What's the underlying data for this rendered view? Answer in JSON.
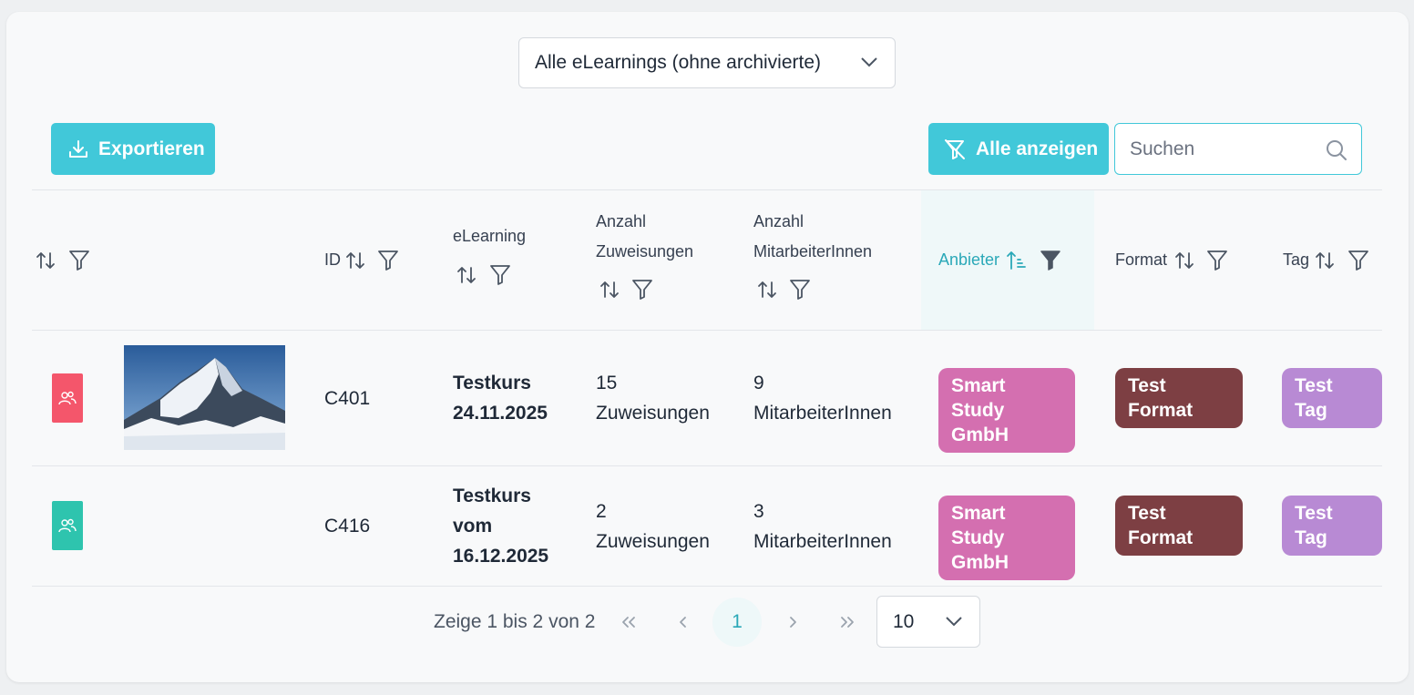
{
  "filter_dropdown": {
    "selected": "Alle eLearnings (ohne archivierte)"
  },
  "toolbar": {
    "export_label": "Exportieren",
    "show_all_label": "Alle anzeigen",
    "search_placeholder": "Suchen"
  },
  "columns": {
    "id": "ID",
    "elearning": "eLearning",
    "assignments_line1": "Anzahl",
    "assignments_line2": "Zuweisungen",
    "employees_line1": "Anzahl",
    "employees_line2": "MitarbeiterInnen",
    "provider": "Anbieter",
    "format": "Format",
    "tag": "Tag"
  },
  "rows": [
    {
      "status_color": "#f4566b",
      "has_image": true,
      "id": "C401",
      "title_lines": [
        "Testkurs",
        "24.11.2025"
      ],
      "assignments_count": "15",
      "assignments_unit": "Zuweisungen",
      "employees_count": "9",
      "employees_unit": "MitarbeiterInnen",
      "provider_lines": [
        "Smart Study",
        "GmbH"
      ],
      "format_lines": [
        "Test",
        "Format"
      ],
      "tag_lines": [
        "Test",
        "Tag"
      ]
    },
    {
      "status_color": "#2ec4ae",
      "has_image": false,
      "id": "C416",
      "title_lines": [
        "Testkurs",
        "vom",
        "16.12.2025"
      ],
      "assignments_count": "2",
      "assignments_unit": "Zuweisungen",
      "employees_count": "3",
      "employees_unit": "MitarbeiterInnen",
      "provider_lines": [
        "Smart Study",
        "GmbH"
      ],
      "format_lines": [
        "Test",
        "Format"
      ],
      "tag_lines": [
        "Test",
        "Tag"
      ]
    }
  ],
  "pagination": {
    "summary": "Zeige 1 bis 2 von 2",
    "current_page": "1",
    "per_page": "10"
  },
  "colors": {
    "accent": "#41c8d9",
    "provider_pill": "#d46fb0",
    "format_pill": "#7d3f43",
    "tag_pill": "#b88ad4"
  }
}
